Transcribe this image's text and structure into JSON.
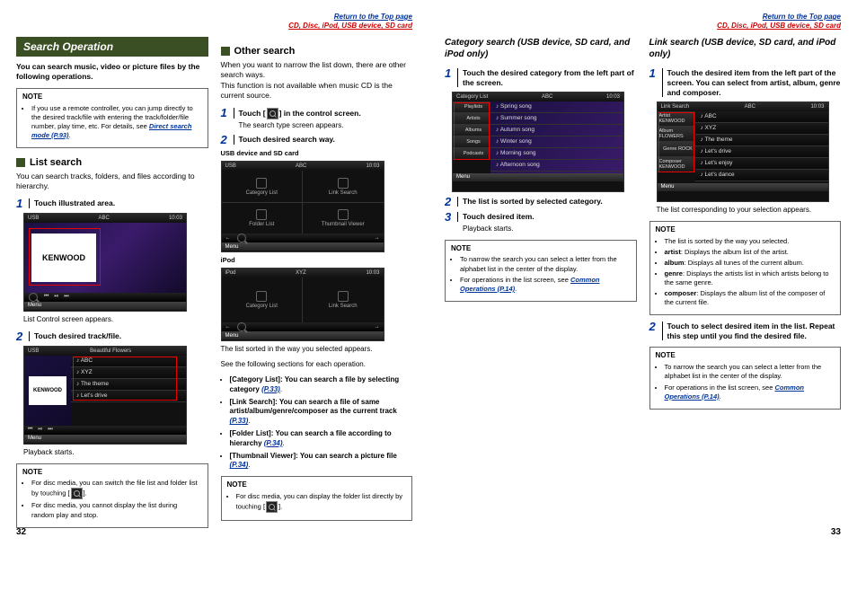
{
  "header": {
    "return": "Return to the Top page",
    "breadcrumb": "CD, Disc, iPod, USB device, SD card"
  },
  "p32": {
    "title": "Search Operation",
    "intro": "You can search music, video or picture files by the following operations.",
    "note1": {
      "title": "NOTE",
      "item": "If you use a remote controller, you can jump directly to the desired track/file with entering the track/folder/file number, play time, etc. For details, see ",
      "link": "Direct search mode (P.93)"
    },
    "list_search": {
      "heading": "List search",
      "desc": "You can search tracks, folders, and files according to hierarchy.",
      "step1": "Touch illustrated area.",
      "shot1_cap": "List Control screen appears.",
      "step2": "Touch desired track/file.",
      "shot2_cap": "Playback starts.",
      "kenwood": "KENWOOD",
      "usb": "USB",
      "abc": "ABC",
      "time": "10:03",
      "menu": "Menu",
      "flowers": "Beautiful Flowers",
      "tracks": [
        "♪ ABC",
        "♪ XYZ",
        "♪ The theme",
        "♪ Let's drive"
      ]
    },
    "note2": {
      "title": "NOTE",
      "items": [
        "For disc media, you can switch the file list and folder list by touching [",
        "For disc media, you cannot display the list during random play and stop."
      ]
    },
    "other": {
      "heading": "Other search",
      "desc1": "When you want to narrow the list down, there are other search ways.",
      "desc2": "This function is not available when music CD is the current source.",
      "step1a": "Touch [",
      "step1b": "] in the control screen.",
      "step1_sub": "The search type screen appears.",
      "step2": "Touch desired search way.",
      "usb_label": "USB device and SD card",
      "ipod_label": "iPod",
      "g4": [
        "Category List",
        "Link Search",
        "Folder List",
        "Thumbnail Viewer"
      ],
      "g2": [
        "Category List",
        "Link Search"
      ],
      "cap": "The list sorted in the way you selected appears.",
      "cap2": "See the following sections for each operation.",
      "bullets": [
        {
          "t": "[Category List]: You can search a file by selecting category ",
          "l": "(P.33)"
        },
        {
          "t": "[Link Search]: You can search a file of same artist/album/genre/composer as the current track ",
          "l": "(P.33)"
        },
        {
          "t": "[Folder List]: You can search a file according to hierarchy ",
          "l": "(P.34)"
        },
        {
          "t": "[Thumbnail Viewer]: You can search a picture file ",
          "l": "(P.34)"
        }
      ],
      "note": {
        "title": "NOTE",
        "item": "For disc media, you can display the folder list directly by touching ["
      }
    },
    "num": "32"
  },
  "p33": {
    "cat": {
      "heading": "Category search (USB device, SD card, and iPod only)",
      "step1": "Touch the desired category from the left part of the screen.",
      "title_bar": "Category List",
      "side": [
        "Playlists",
        "Artists",
        "Albums",
        "Songs",
        "Podcasts"
      ],
      "main": [
        "♪ Spring song",
        "♪ Summer song",
        "♪ Autumn song",
        "♪ Winter song",
        "♪ Morning song",
        "♪ Afternoon song"
      ],
      "step2": "The list is sorted by selected category.",
      "step3": "Touch desired item.",
      "step3_sub": "Playback starts.",
      "note": {
        "title": "NOTE",
        "items": [
          "To narrow the search you can select a letter from the alphabet list in the center of the display.",
          {
            "t": "For operations in the list screen, see ",
            "l": "Common Operations (P.14)"
          }
        ]
      }
    },
    "link": {
      "heading": "Link search (USB device, SD card, and iPod only)",
      "step1": "Touch the desired item from the left part of the screen. You can select from artist, album, genre and composer.",
      "title_bar": "Link Search",
      "side": [
        "Artist KENWOOD",
        "Album FLOWERS",
        "Genre ROCK",
        "Composer KENWOOD"
      ],
      "main": [
        "♪ ABC",
        "♪ XYZ",
        "♪ The theme",
        "♪ Let's drive",
        "♪ Let's enjoy",
        "♪ Let's dance"
      ],
      "cap": "The list corresponding to your selection appears.",
      "note1": {
        "title": "NOTE",
        "intro": "The list is sorted by the way you selected.",
        "items": [
          {
            "b": "artist",
            "t": ": Displays the album list of the artist."
          },
          {
            "b": "album",
            "t": ": Displays all tunes of the current album."
          },
          {
            "b": "genre",
            "t": ": Displays the artists list in which artists belong to the same genre."
          },
          {
            "b": "composer",
            "t": ": Displays the album list of the composer of the current file."
          }
        ]
      },
      "step2": "Touch to select desired item in the list. Repeat this step until you find the desired file.",
      "note2": {
        "title": "NOTE",
        "items": [
          "To narrow the search you can select a letter from the alphabet list in the center of the display.",
          {
            "t": "For operations in the list screen, see ",
            "l": "Common Operations (P.14)"
          }
        ]
      }
    },
    "num": "33"
  }
}
